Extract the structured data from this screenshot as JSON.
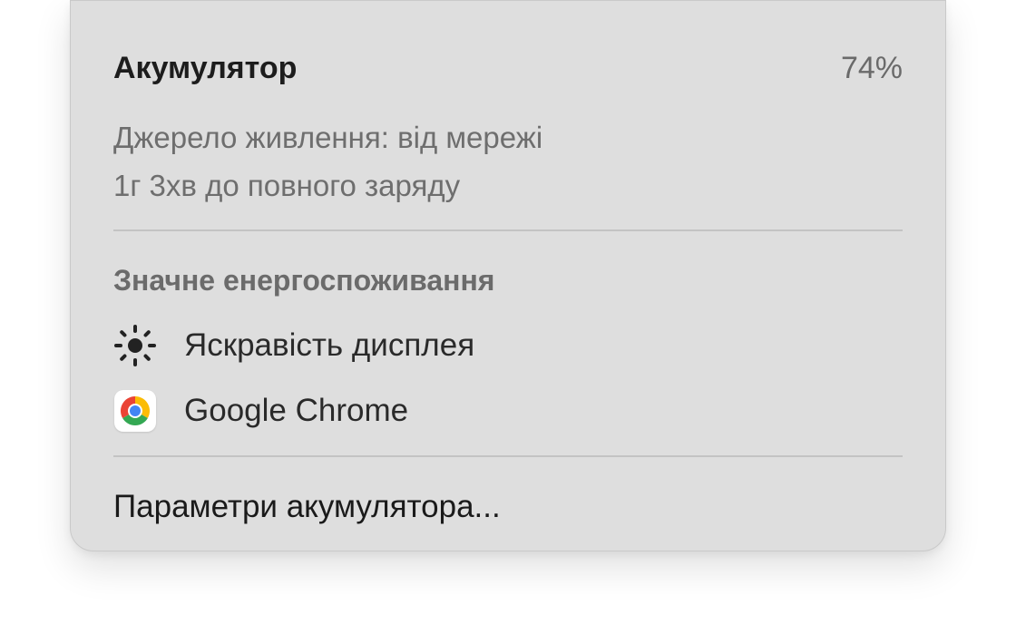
{
  "battery": {
    "title": "Акумулятор",
    "percent": "74%",
    "power_source": "Джерело живлення: від мережі",
    "time_to_full": "1г 3хв до повного заряду"
  },
  "energy": {
    "section_title": "Значне енергоспоживання",
    "items": [
      {
        "label": "Яскравість дисплея",
        "icon": "brightness-icon"
      },
      {
        "label": "Google Chrome",
        "icon": "chrome-icon"
      }
    ]
  },
  "footer": {
    "settings_label": "Параметри акумулятора..."
  },
  "colors": {
    "panel_bg": "#dedede",
    "divider": "#c3c3c3",
    "text_primary": "#1d1d1d",
    "text_secondary": "#6e6e6e"
  }
}
